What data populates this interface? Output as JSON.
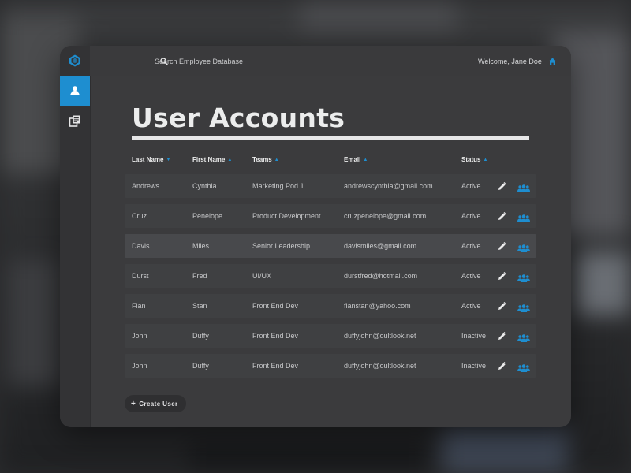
{
  "search": {
    "placeholder": "Search Employee Database"
  },
  "header": {
    "welcome": "Welcome, Jane Doe"
  },
  "main": {
    "title": "User Accounts"
  },
  "table": {
    "columns": [
      {
        "label": "Last Name",
        "sort": "desc"
      },
      {
        "label": "First Name",
        "sort": "asc"
      },
      {
        "label": "Teams",
        "sort": "asc"
      },
      {
        "label": "Email",
        "sort": "asc"
      },
      {
        "label": "Status",
        "sort": "asc"
      }
    ],
    "rows": [
      {
        "last": "Andrews",
        "first": "Cynthia",
        "team": "Marketing Pod 1",
        "email": "andrewscynthia@gmail.com",
        "status": "Active"
      },
      {
        "last": "Cruz",
        "first": "Penelope",
        "team": "Product Development",
        "email": "cruzpenelope@gmail.com",
        "status": "Active"
      },
      {
        "last": "Davis",
        "first": "Miles",
        "team": "Senior Leadership",
        "email": "davismiles@gmail.com",
        "status": "Active"
      },
      {
        "last": "Durst",
        "first": "Fred",
        "team": "UI/UX",
        "email": "durstfred@hotmail.com",
        "status": "Active"
      },
      {
        "last": "Flan",
        "first": "Stan",
        "team": "Front End Dev",
        "email": "flanstan@yahoo.com",
        "status": "Active"
      },
      {
        "last": "John",
        "first": "Duffy",
        "team": "Front End Dev",
        "email": "duffyjohn@oultlook.net",
        "status": "Inactive"
      },
      {
        "last": "John",
        "first": "Duffy",
        "team": "Front End Dev",
        "email": "duffyjohn@oultlook.net",
        "status": "Inactive"
      }
    ]
  },
  "actions": {
    "create_label": "Create User",
    "create_icon": "plus-icon"
  },
  "icons": {
    "logo": "logo-icon",
    "nav_users": "user-icon",
    "nav_documents": "documents-icon",
    "search": "search-icon",
    "home": "home-icon",
    "edit": "pencil-icon",
    "team": "group-icon"
  },
  "colors": {
    "accent": "#1e8ed0",
    "panel": "#3b3b3d",
    "row": "#3f4042",
    "row_highlight": "#48494c",
    "text": "#c6c7c9",
    "title": "#eceded"
  }
}
